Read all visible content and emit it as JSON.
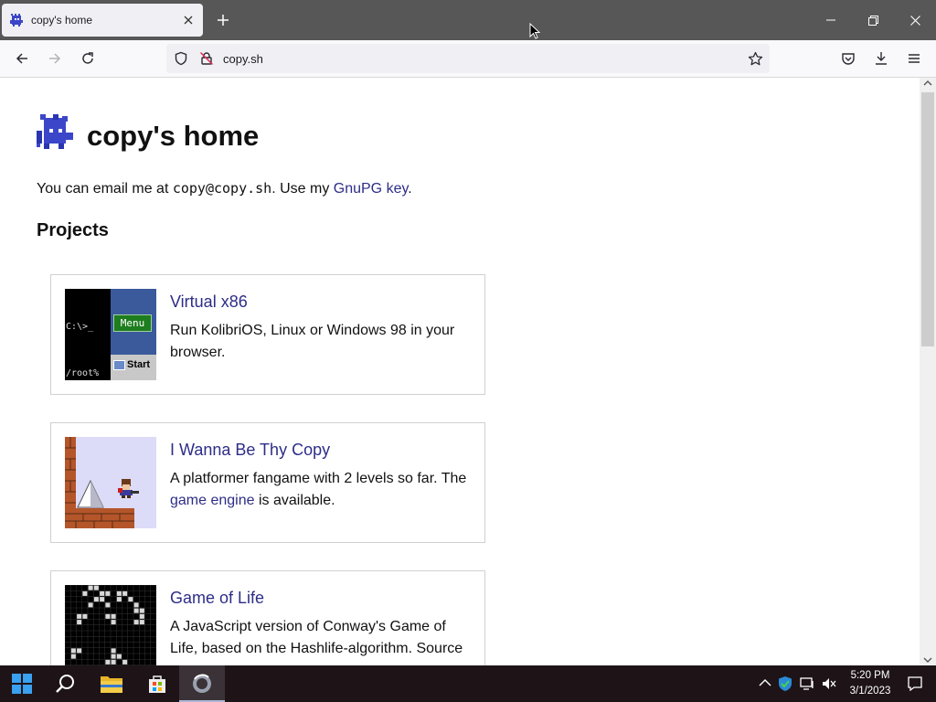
{
  "browser": {
    "tab": {
      "title": "copy's home"
    },
    "address_bar": {
      "url": "copy.sh"
    }
  },
  "page": {
    "title": "copy's home",
    "intro": {
      "prefix": "You can email me at ",
      "email": "copy@copy.sh",
      "middle": ". Use my ",
      "link_text": "GnuPG key",
      "suffix": "."
    },
    "projects_heading": "Projects",
    "projects": [
      {
        "title": "Virtual x86",
        "description": "Run KolibriOS, Linux or Windows 98 in your browser.",
        "thumb": {
          "prompt": "C:\\>_",
          "menu": "Menu",
          "path": "/root%",
          "start": "Start"
        }
      },
      {
        "title": "I Wanna Be Thy Copy",
        "description_prefix": "A platformer fangame with 2 levels so far. The ",
        "description_link": "game engine",
        "description_suffix": " is available."
      },
      {
        "title": "Game of Life",
        "description": "A JavaScript version of Conway's Game of Life, based on the Hashlife-algorithm. Source"
      }
    ]
  },
  "taskbar": {
    "time": "5:20 PM",
    "date": "3/1/2023"
  },
  "colors": {
    "link": "#2d2d88",
    "titlebar": "#575757",
    "taskbar": "#1e1418"
  }
}
